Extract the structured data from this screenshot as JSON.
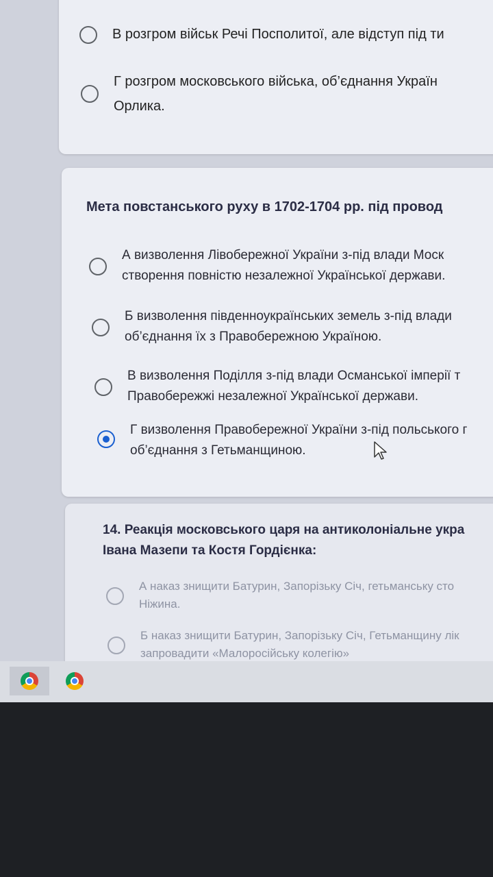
{
  "q12": {
    "options": [
      {
        "text": "В розгром військ Речі Посполитої, але відступ під ти"
      },
      {
        "line1": "Г розгром московського війська, об’єднання Україн",
        "line2": "Орлика."
      }
    ]
  },
  "q13": {
    "title": "Мета повстанського руху в 1702-1704 рр. під провод",
    "selected_index": 3,
    "options": [
      {
        "line1": "А визволення Лівобережної України з-під влади Моск",
        "line2": "створення повністю незалежної Української держави."
      },
      {
        "line1": "Б визволення південноукраїнських земель з-під влади",
        "line2": "об’єднання їх з Правобережною Україною."
      },
      {
        "line1": "В визволення Поділля з-під влади Османської імперії т",
        "line2": "Правобережжі незалежної Української держави."
      },
      {
        "line1": "Г визволення Правобережної України з-під польського г",
        "line2": "об’єднання з Гетьманщиною."
      }
    ]
  },
  "q14": {
    "title_line1": "14. Реакція московського царя на антиколоніальне укра",
    "title_line2": "Івана Мазепи та Костя Гордієнка:",
    "options": [
      {
        "line1": "А наказ знищити Батурин, Запорізьку Січ, гетьманську сто",
        "line2": "Ніжина."
      },
      {
        "line1": "Б наказ знищити Батурин, Запорізьку Січ, Гетьманщину лік",
        "line2": "запровадити «Малоросійську колегію»"
      }
    ]
  },
  "taskbar": {
    "icons": [
      "chrome-icon",
      "chrome-profile-icon"
    ]
  }
}
